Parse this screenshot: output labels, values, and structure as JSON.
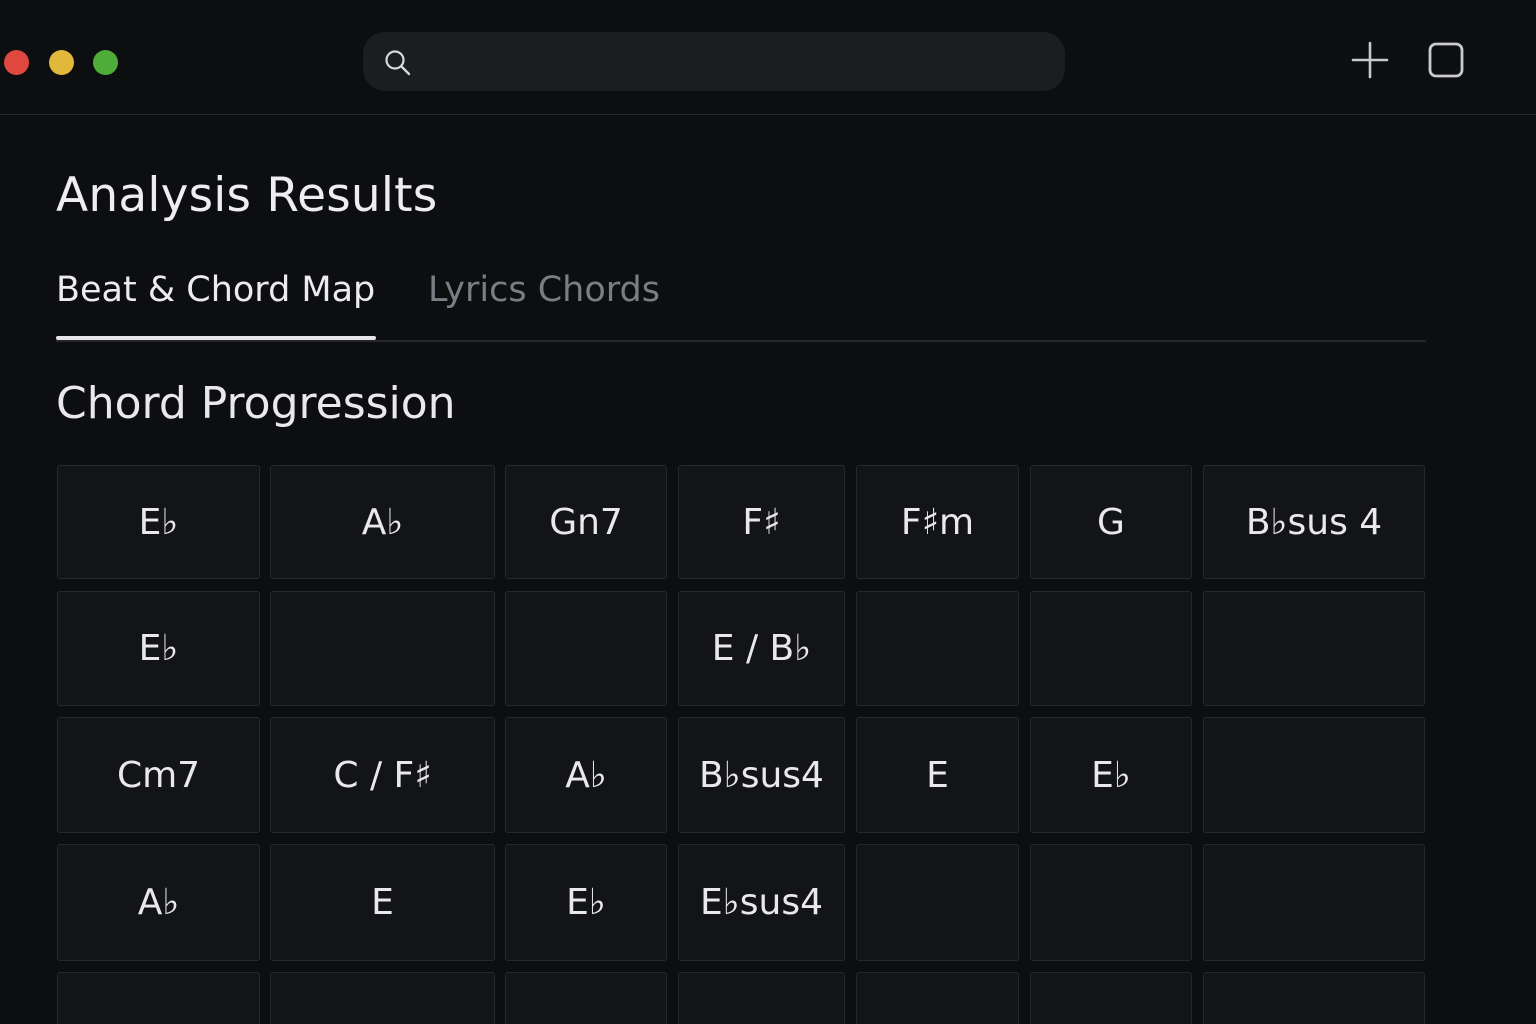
{
  "search": {
    "placeholder": "",
    "value": ""
  },
  "page": {
    "title": "Analysis Results",
    "tabs": [
      {
        "label": "Beat & Chord Map",
        "active": true
      },
      {
        "label": "Lyrics Chords",
        "active": false
      }
    ],
    "section_title": "Chord Progression"
  },
  "chord_grid": {
    "rows": [
      [
        "E♭",
        "A♭",
        "Gn7",
        "F♯",
        "F♯m",
        "G",
        "B♭sus 4"
      ],
      [
        "E♭",
        "",
        "",
        "E / B♭",
        "",
        "",
        ""
      ],
      [
        "Cm7",
        "C / F♯",
        "A♭",
        "B♭sus4",
        "E",
        "E♭",
        ""
      ],
      [
        "A♭",
        "E",
        "E♭",
        "E♭sus4",
        "",
        "",
        ""
      ],
      [
        "",
        "",
        "",
        "",
        "",
        "",
        ""
      ]
    ]
  },
  "colors": {
    "background": "#0d0e10",
    "cell_background": "#131417",
    "traffic_red": "#e0473f",
    "traffic_yellow": "#e1b83c",
    "traffic_green": "#4ead38"
  },
  "icons": [
    "search-icon",
    "plus-icon",
    "window-icon"
  ]
}
